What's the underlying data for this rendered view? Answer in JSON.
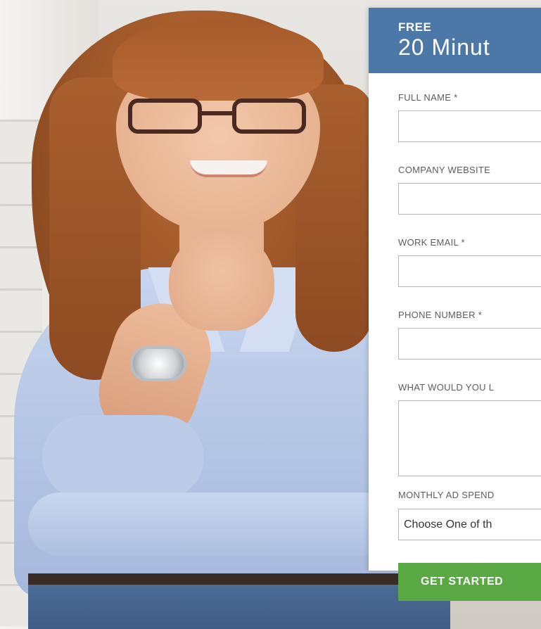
{
  "form": {
    "header_kicker": "FREE",
    "header_title": "20 Minut",
    "fields": [
      {
        "label": "FULL NAME *",
        "value": ""
      },
      {
        "label": "COMPANY WEBSITE",
        "value": ""
      },
      {
        "label": "WORK EMAIL *",
        "value": ""
      },
      {
        "label": "PHONE NUMBER *",
        "value": ""
      },
      {
        "label": "WHAT WOULD YOU L",
        "value": ""
      }
    ],
    "select": {
      "label": "MONTHLY AD SPEND",
      "selected": "Choose One of th"
    },
    "submit_label": "GET STARTED"
  },
  "colors": {
    "header_bg": "#4c78a8",
    "button_bg": "#5aa844"
  }
}
